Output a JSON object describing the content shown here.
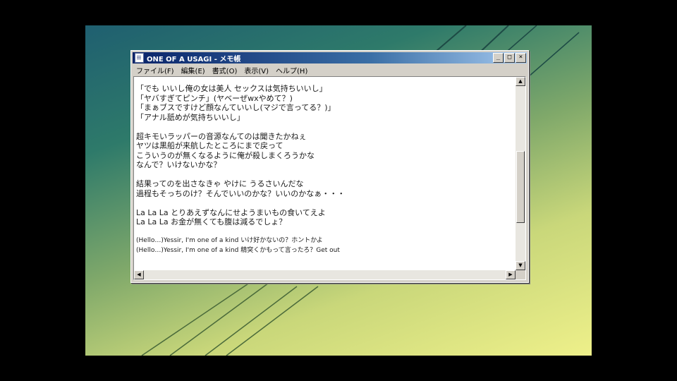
{
  "window": {
    "title": "ONE OF A USAGI - メモ帳",
    "buttons": [
      "_",
      "□",
      "×"
    ]
  },
  "menu": [
    "ファイル(F)",
    "編集(E)",
    "書式(O)",
    "表示(V)",
    "ヘルプ(H)"
  ],
  "lines": [
    "「でも いいし俺の女は美人 セックスは気持ちいいし」",
    "「ヤバすぎてピンチ」(ヤベーぜwxやめて？)",
    "「まぁブスですけど顔なんていいし(マジで言ってる？)」",
    "「アナル舐めが気持ちいいし」",
    "",
    "超キモいラッパーの音源なんてのは聞きたかねぇ",
    "ヤツは黒船が来航したところにまで戻って",
    "こういうのが無くなるように俺が殺しまくろうかな",
    "なんで？いけないかな？",
    "",
    "結果ってのを出さなきゃ やけに うるさいんだな",
    "過程もそっちのけ？そんでいいのかな？いいのかなぁ・・・",
    "",
    "La La La とりあえずなんにせようまいもの食いてえよ",
    "La La La お金が無くても腹は減るでしょ？",
    "",
    "(Hello…)Yessir, I'm one of a kind いけ好かないの？ホントかよ",
    "(Hello…)Yessir, I'm one of a kind 精突くかもって言ったろ？Get out"
  ],
  "icons": {
    "app": "notepad-icon",
    "scroll_up": "arrow-up-icon",
    "scroll_down": "arrow-down-icon",
    "scroll_left": "arrow-left-icon",
    "scroll_right": "arrow-right-icon"
  },
  "colors": {
    "title_bar_start": "#0a246a",
    "title_bar_end": "#a6caf0",
    "chrome": "#d4d0c8"
  }
}
